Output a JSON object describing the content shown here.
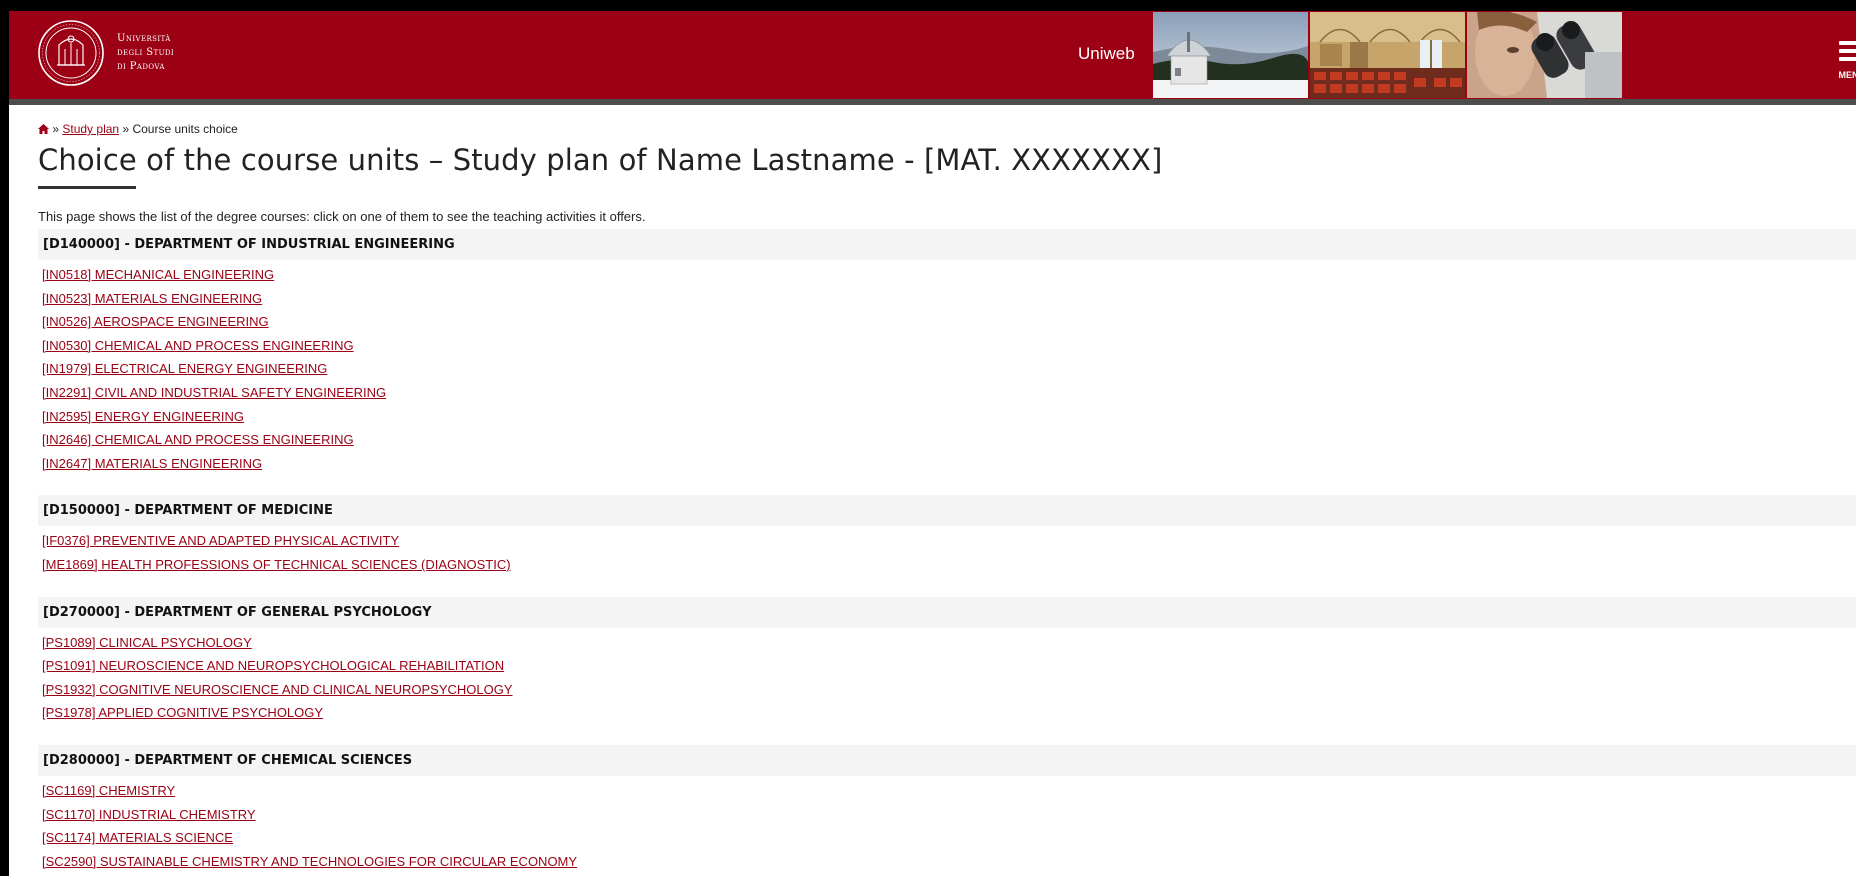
{
  "header": {
    "university_name_lines": [
      "Università",
      "degli Studi",
      "di Padova"
    ],
    "app_name": "Uniweb",
    "menu_label": "MENU",
    "colors": {
      "brand_red": "#9b0014",
      "header_bottom": "#4d4d4d"
    },
    "photos": [
      "observatory-photo",
      "frescoed-hall-photo",
      "microscope-photo"
    ]
  },
  "breadcrumb": {
    "home_icon": "home-icon",
    "separator": "»",
    "study_plan": "Study plan",
    "current": "Course units choice"
  },
  "page": {
    "title": "Choice of the course units – Study plan of Name Lastname - [MAT. XXXXXXX]",
    "intro": "This page shows the list of the degree courses: click on one of them to see the teaching activities it offers."
  },
  "departments": [
    {
      "name": "[D140000] - DEPARTMENT OF INDUSTRIAL ENGINEERING",
      "courses": [
        "[IN0518] MECHANICAL ENGINEERING",
        "[IN0523] MATERIALS ENGINEERING",
        "[IN0526] AEROSPACE ENGINEERING",
        "[IN0530] CHEMICAL AND PROCESS ENGINEERING",
        "[IN1979] ELECTRICAL ENERGY ENGINEERING",
        "[IN2291] CIVIL AND INDUSTRIAL SAFETY ENGINEERING",
        "[IN2595] ENERGY ENGINEERING",
        "[IN2646] CHEMICAL AND PROCESS ENGINEERING",
        "[IN2647] MATERIALS ENGINEERING"
      ]
    },
    {
      "name": "[D150000] - DEPARTMENT OF MEDICINE",
      "courses": [
        "[IF0376] PREVENTIVE AND ADAPTED PHYSICAL ACTIVITY",
        "[ME1869] HEALTH PROFESSIONS OF TECHNICAL SCIENCES (DIAGNOSTIC)"
      ]
    },
    {
      "name": "[D270000] - DEPARTMENT OF GENERAL PSYCHOLOGY",
      "courses": [
        "[PS1089] CLINICAL PSYCHOLOGY",
        "[PS1091] NEUROSCIENCE AND NEUROPSYCHOLOGICAL REHABILITATION",
        "[PS1932] COGNITIVE NEUROSCIENCE AND CLINICAL NEUROPSYCHOLOGY",
        "[PS1978] APPLIED COGNITIVE PSYCHOLOGY"
      ]
    },
    {
      "name": "[D280000] - DEPARTMENT OF CHEMICAL SCIENCES",
      "courses": [
        "[SC1169] CHEMISTRY",
        "[SC1170] INDUSTRIAL CHEMISTRY",
        "[SC1174] MATERIALS SCIENCE",
        "[SC2590] SUSTAINABLE CHEMISTRY AND TECHNOLOGIES FOR CIRCULAR ECONOMY"
      ]
    }
  ]
}
